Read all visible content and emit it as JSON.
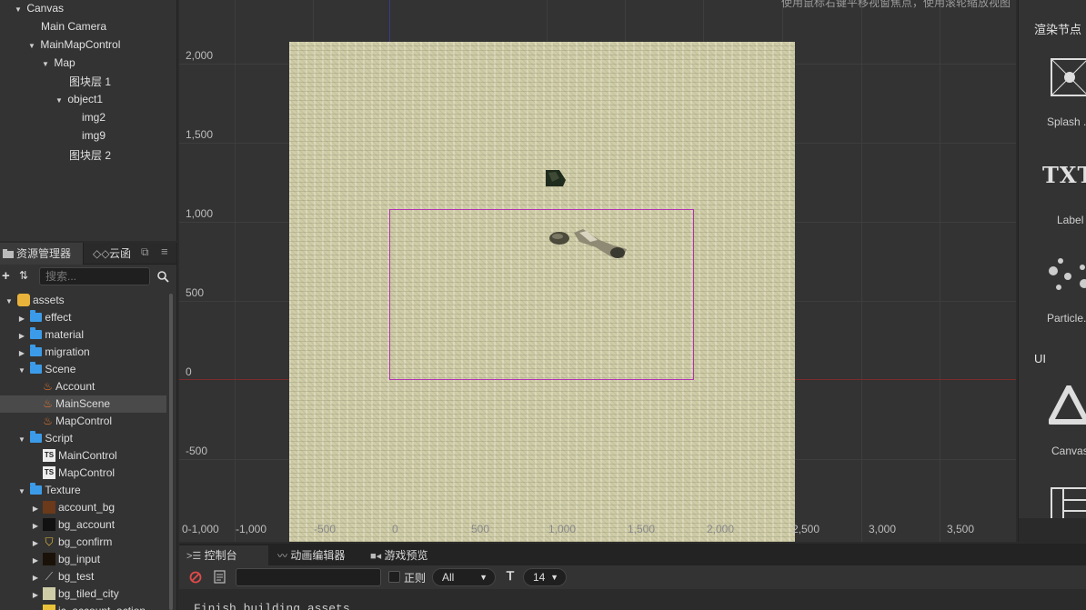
{
  "hierarchy": {
    "nodes": [
      {
        "label": "Canvas",
        "expanded": true
      },
      {
        "label": "Main Camera"
      },
      {
        "label": "MainMapControl",
        "expanded": true
      },
      {
        "label": "Map",
        "expanded": true
      },
      {
        "label": "图块层 1"
      },
      {
        "label": "object1",
        "expanded": true
      },
      {
        "label": "img2"
      },
      {
        "label": "img9"
      },
      {
        "label": "图块层 2"
      }
    ]
  },
  "assets": {
    "tab_label": "资源管理器",
    "cloud_tab_label": "云函",
    "search_placeholder": "搜索...",
    "tree": [
      {
        "label": "assets",
        "type": "root"
      },
      {
        "label": "effect",
        "type": "folder"
      },
      {
        "label": "material",
        "type": "folder"
      },
      {
        "label": "migration",
        "type": "folder"
      },
      {
        "label": "Scene",
        "type": "folder"
      },
      {
        "label": "Account",
        "type": "scene"
      },
      {
        "label": "MainScene",
        "type": "scene",
        "selected": true
      },
      {
        "label": "MapControl",
        "type": "scene"
      },
      {
        "label": "Script",
        "type": "folder"
      },
      {
        "label": "MainControl",
        "type": "ts"
      },
      {
        "label": "MapControl",
        "type": "ts"
      },
      {
        "label": "Texture",
        "type": "folder"
      },
      {
        "label": "account_bg",
        "type": "image"
      },
      {
        "label": "bg_account",
        "type": "image"
      },
      {
        "label": "bg_confirm",
        "type": "image"
      },
      {
        "label": "bg_input",
        "type": "image"
      },
      {
        "label": "bg_test",
        "type": "image"
      },
      {
        "label": "bg_tiled_city",
        "type": "image"
      },
      {
        "label": "ic_account_action",
        "type": "image"
      }
    ]
  },
  "scene": {
    "hint": "使用鼠标右键平移视窗焦点，使用滚轮缩放视图",
    "y_ticks": [
      "2,000",
      "1,500",
      "1,000",
      "500",
      "0",
      "-500"
    ],
    "x_ticks": [
      "0-1,000",
      "-1,000",
      "-500",
      "0",
      "500",
      "1,000",
      "1,500",
      "2,000",
      "2,500",
      "3,000",
      "3,500"
    ]
  },
  "right_panel": {
    "title": "渲染节点",
    "items": [
      "Splash ..",
      "Label",
      "Particle..."
    ],
    "txt_icon_text": "TXT",
    "section_ui": "UI",
    "ui_items": [
      "Canvas"
    ]
  },
  "console": {
    "tabs": [
      "控制台",
      "动画编辑器",
      "游戏预览"
    ],
    "regex_label": "正则",
    "level_select": "All",
    "font_size": "14",
    "log_line": "Finish building assets"
  },
  "colors": {
    "panel_bg": "#333333",
    "folder_blue": "#3c9be8",
    "scene_icon": "#e8772e",
    "view_rect": "#b330b3",
    "x_axis": "#7a2b2b"
  }
}
